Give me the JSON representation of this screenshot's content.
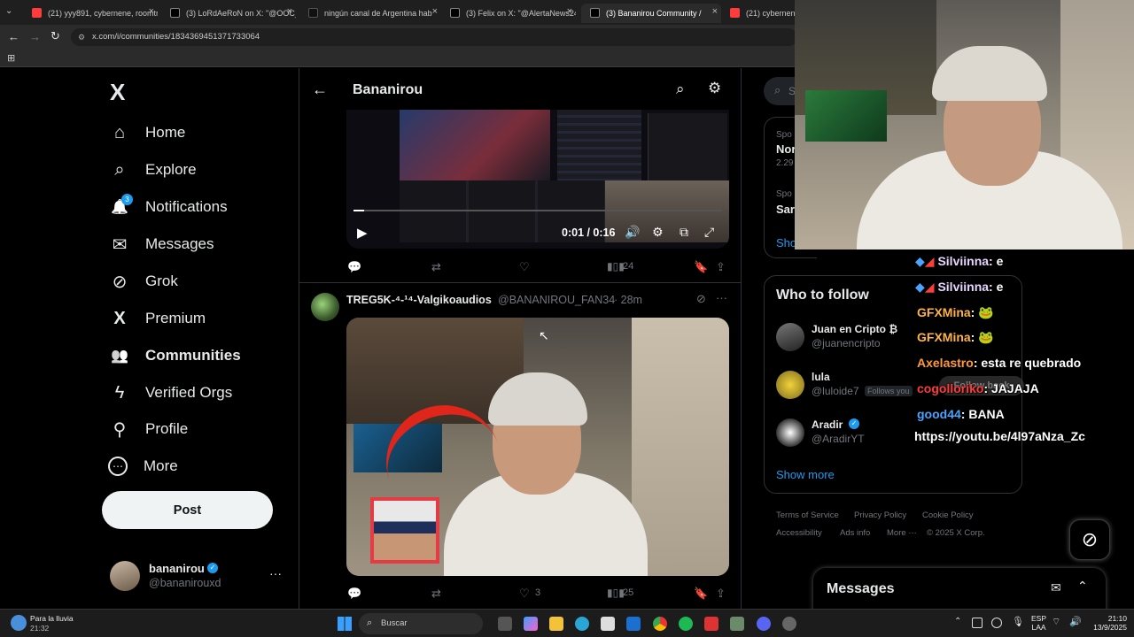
{
  "browser": {
    "tabs": [
      {
        "title": "(21) yyy891, cybernene, roomtr",
        "color": "#ff3b3b"
      },
      {
        "title": "(3) LoRdAeRoN on X: \"@OOC_I",
        "color": "#444"
      },
      {
        "title": "ningún canal de Argentina hab",
        "color": "#111"
      },
      {
        "title": "(3) Felix on X: \"@AlertaNews24",
        "color": "#444"
      },
      {
        "title": "(3) Bananirou Community /",
        "color": "#444"
      },
      {
        "title": "(21) cybernene -",
        "color": "#ff3b3b"
      }
    ],
    "url": "x.com/i/communities/1834369451371733064"
  },
  "sidebar": {
    "logo": "X",
    "items": [
      {
        "label": "Home",
        "icon": "home-icon",
        "glyph": "⌂"
      },
      {
        "label": "Explore",
        "icon": "search-icon",
        "glyph": "⌕"
      },
      {
        "label": "Notifications",
        "icon": "bell-icon",
        "glyph": "🔔"
      },
      {
        "label": "Messages",
        "icon": "mail-icon",
        "glyph": "✉"
      },
      {
        "label": "Grok",
        "icon": "grok-icon",
        "glyph": "⊘"
      },
      {
        "label": "Premium",
        "icon": "x-premium-icon",
        "glyph": "X"
      },
      {
        "label": "Communities",
        "icon": "communities-icon",
        "glyph": "👥"
      },
      {
        "label": "Verified Orgs",
        "icon": "lightning-icon",
        "glyph": "ϟ"
      },
      {
        "label": "Profile",
        "icon": "person-icon",
        "glyph": "⚲"
      },
      {
        "label": "More",
        "icon": "more-circle-icon",
        "glyph": "⋯"
      }
    ],
    "notifications_badge": "3",
    "post_label": "Post",
    "account": {
      "name": "bananirou",
      "handle": "@bananirouxd"
    }
  },
  "header": {
    "title": "Bananirou"
  },
  "post1": {
    "video_time": "0:01 / 0:16",
    "views": "24"
  },
  "post2": {
    "author": "TREG5K-⁴-¹⁴-Valgikoaudios",
    "handle": "@BANANIROU_FAN34",
    "time": "· 28m",
    "likes": "3",
    "views": "25"
  },
  "right": {
    "search_placeholder": "S",
    "trend1_label": "Spo",
    "trend1_title": "Nor",
    "trend1_count": "2.29",
    "trend2_label": "Spo",
    "trend2_title": "Sar",
    "show_partial": "Sho",
    "who_to_follow": "Who to follow",
    "suggestions": [
      {
        "name": "Juan en Cripto ₿",
        "handle": "@juanencripto",
        "extra": ""
      },
      {
        "name": "lula",
        "handle": "@luloide7",
        "extra": "Follows you"
      },
      {
        "name": "Aradir",
        "handle": "@AradirYT",
        "extra": ""
      }
    ],
    "follow_back": "Follow back",
    "show_more": "Show more",
    "footer": [
      "Terms of Service",
      "Privacy Policy",
      "Cookie Policy",
      "Accessibility",
      "Ads info",
      "More ···",
      "© 2025 X Corp."
    ]
  },
  "messages_drawer": {
    "title": "Messages"
  },
  "chat": [
    {
      "user": "Silviinna",
      "msg": ": e",
      "color": "#e6d5ff"
    },
    {
      "user": "Silviinna",
      "msg": ": e",
      "color": "#e6d5ff"
    },
    {
      "user": "GFXMina",
      "msg": ": 🐸",
      "color": "#ffb347"
    },
    {
      "user": "GFXMina",
      "msg": ": 🐸",
      "color": "#ffb347"
    },
    {
      "user": "Axelastro",
      "msg": ": esta re quebrado",
      "color": "#ff9a3c"
    },
    {
      "user": "cogolloriko",
      "msg": ": JAJAJA",
      "color": "#ff3b3b"
    },
    {
      "user": "good44",
      "msg": ": BANA",
      "color": "#4aa3ff"
    }
  ],
  "chat_link": "https://youtu.be/4l97aNza_Zc",
  "taskbar": {
    "weather": "Para la lluvia",
    "weather_time": "21:32",
    "search": "Buscar",
    "lang": "ESP",
    "lang2": "LAA",
    "clock": "21:10",
    "date": "13/9/2025"
  }
}
